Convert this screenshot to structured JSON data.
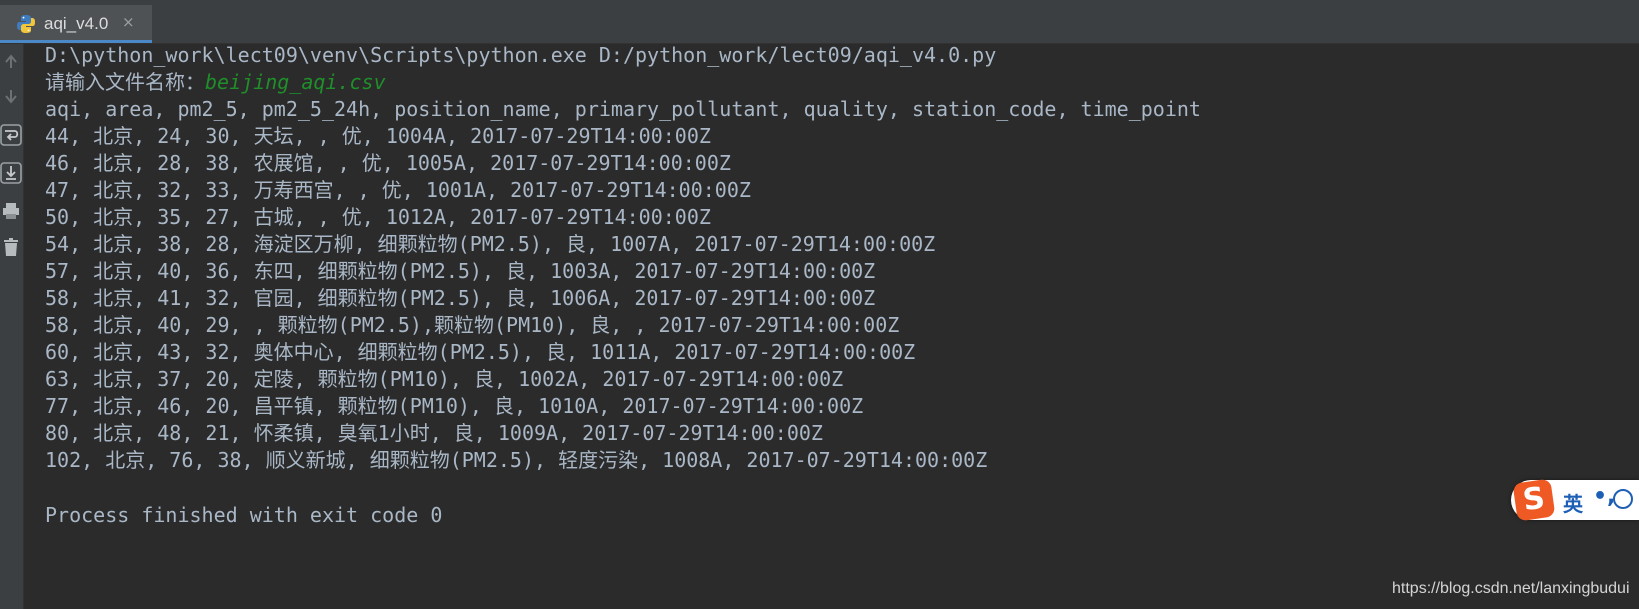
{
  "tab": {
    "title": "aqi_v4.0",
    "close_glyph": "×",
    "icon": "python-file-icon"
  },
  "gutter": {
    "buttons": [
      "rerun-up-icon",
      "rerun-down-icon",
      "soft-wrap-icon",
      "scroll-to-end-icon",
      "print-icon",
      "trash-icon"
    ]
  },
  "console": {
    "command": "D:\\python_work\\lect09\\venv\\Scripts\\python.exe D:/python_work/lect09/aqi_v4.0.py",
    "prompt_label": "请输入文件名称：",
    "prompt_value": "beijing_aqi.csv",
    "header": "aqi, area, pm2_5, pm2_5_24h, position_name, primary_pollutant, quality, station_code, time_point",
    "rows": [
      "44, 北京, 24, 30, 天坛, , 优, 1004A, 2017-07-29T14:00:00Z",
      "46, 北京, 28, 38, 农展馆, , 优, 1005A, 2017-07-29T14:00:00Z",
      "47, 北京, 32, 33, 万寿西宫, , 优, 1001A, 2017-07-29T14:00:00Z",
      "50, 北京, 35, 27, 古城, , 优, 1012A, 2017-07-29T14:00:00Z",
      "54, 北京, 38, 28, 海淀区万柳, 细颗粒物(PM2.5), 良, 1007A, 2017-07-29T14:00:00Z",
      "57, 北京, 40, 36, 东四, 细颗粒物(PM2.5), 良, 1003A, 2017-07-29T14:00:00Z",
      "58, 北京, 41, 32, 官园, 细颗粒物(PM2.5), 良, 1006A, 2017-07-29T14:00:00Z",
      "58, 北京, 40, 29, , 颗粒物(PM2.5),颗粒物(PM10), 良, , 2017-07-29T14:00:00Z",
      "60, 北京, 43, 32, 奥体中心, 细颗粒物(PM2.5), 良, 1011A, 2017-07-29T14:00:00Z",
      "63, 北京, 37, 20, 定陵, 颗粒物(PM10), 良, 1002A, 2017-07-29T14:00:00Z",
      "77, 北京, 46, 20, 昌平镇, 颗粒物(PM10), 良, 1010A, 2017-07-29T14:00:00Z",
      "80, 北京, 48, 21, 怀柔镇, 臭氧1小时, 良, 1009A, 2017-07-29T14:00:00Z",
      "102, 北京, 76, 38, 顺义新城, 细颗粒物(PM2.5), 轻度污染, 1008A, 2017-07-29T14:00:00Z"
    ],
    "footer": "Process finished with exit code 0"
  },
  "ime": {
    "logo": "S",
    "lang": "英",
    "punct": "•,",
    "emoji_icon": "emoji-icon"
  },
  "watermark": "https://blog.csdn.net/lanxingbudui",
  "colors": {
    "background": "#2b2b2b",
    "text": "#a9b7c6",
    "input": "#1f8f2a",
    "tab_accent": "#4a88c7"
  }
}
